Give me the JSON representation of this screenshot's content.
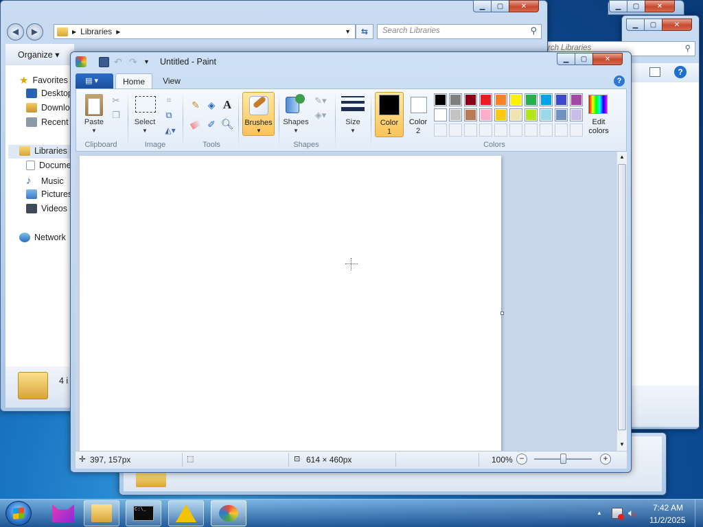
{
  "explorer": {
    "address_root": "Libraries",
    "search_placeholder": "Search Libraries",
    "organize_label": "Organize ▾",
    "nav": {
      "favorites": "Favorites",
      "desktop": "Desktop",
      "downloads": "Downloa",
      "recent": "Recent P",
      "libraries": "Libraries",
      "documents": "Docume",
      "music": "Music",
      "pictures": "Pictures",
      "videos": "Videos",
      "network": "Network"
    },
    "status_count": "4 i"
  },
  "back_window": {
    "search_placeholder": "rch Libraries"
  },
  "paint": {
    "title": "Untitled - Paint",
    "tabs": {
      "home": "Home",
      "view": "View"
    },
    "clipboard": {
      "paste": "Paste",
      "group": "Clipboard"
    },
    "image": {
      "select": "Select",
      "group": "Image"
    },
    "tools": {
      "group": "Tools"
    },
    "brushes": "Brushes",
    "shapes": {
      "label": "Shapes",
      "group": "Shapes"
    },
    "size": "Size",
    "color1": {
      "line1": "Color",
      "line2": "1"
    },
    "color2": {
      "line1": "Color",
      "line2": "2"
    },
    "colors_group": "Colors",
    "edit_colors": {
      "line1": "Edit",
      "line2": "colors"
    },
    "palette_row1": [
      "#000000",
      "#7f7f7f",
      "#880015",
      "#ed1c24",
      "#ff7f27",
      "#fff200",
      "#22b14c",
      "#00a2e8",
      "#3f48cc",
      "#a349a4"
    ],
    "palette_row2": [
      "#ffffff",
      "#c3c3c3",
      "#b97a57",
      "#ffaec9",
      "#ffc90e",
      "#efe4b0",
      "#b5e61d",
      "#99d9ea",
      "#7092be",
      "#c8bfe7"
    ],
    "status": {
      "cursor_pos": "397, 157px",
      "image_size": "614 × 460px",
      "zoom": "100%"
    }
  },
  "taskbar": {
    "time": "7:42 AM",
    "date": "11/2/2025"
  }
}
